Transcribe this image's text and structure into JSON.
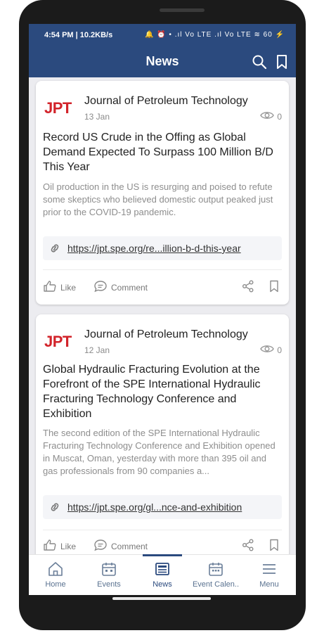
{
  "status_bar": {
    "time": "4:54 PM | 10.2KB/s",
    "indicators": "🔔 ⏰ •  .ıl  Vo LTE .ıl  Vo LTE ≋ 60 ⚡"
  },
  "app_bar": {
    "title": "News",
    "search_icon": "search-icon",
    "bookmark_icon": "bookmark-icon"
  },
  "colors": {
    "primary": "#2b4a7e",
    "logo_red": "#d2232a",
    "muted_text": "#8d8d8d"
  },
  "articles": [
    {
      "source_logo": "JPT",
      "source": "Journal of Petroleum Technology",
      "date": "13 Jan",
      "views": "0",
      "headline": "Record US Crude in the Offing as Global Demand Expected To Surpass 100 Million B/D This Year",
      "summary": "Oil production in the US is resurging and poised to refute some skeptics who believed domestic output peaked just prior to the COVID-19 pandemic.",
      "link": "https://jpt.spe.org/re...illion-b-d-this-year",
      "like_label": "Like",
      "comment_label": "Comment"
    },
    {
      "source_logo": "JPT",
      "source": "Journal of Petroleum Technology",
      "date": "12 Jan",
      "views": "0",
      "headline": "Global Hydraulic Fracturing Evolution at the Forefront of the SPE International Hydraulic Fracturing Technology Conference and Exhibition",
      "summary": "The second edition of the SPE International Hydraulic Fracturing Technology Conference and Exhibition opened in Muscat, Oman, yesterday with more than 395 oil and gas professionals from 90 companies a...",
      "link": "https://jpt.spe.org/gl...nce-and-exhibition",
      "like_label": "Like",
      "comment_label": "Comment"
    }
  ],
  "bottom_nav": {
    "items": [
      {
        "label": "Home",
        "icon": "home-icon",
        "active": false
      },
      {
        "label": "Events",
        "icon": "calendar-icon",
        "active": false
      },
      {
        "label": "News",
        "icon": "news-icon",
        "active": true
      },
      {
        "label": "Event Calen..",
        "icon": "event-calendar-icon",
        "active": false
      },
      {
        "label": "Menu",
        "icon": "menu-icon",
        "active": false
      }
    ]
  }
}
